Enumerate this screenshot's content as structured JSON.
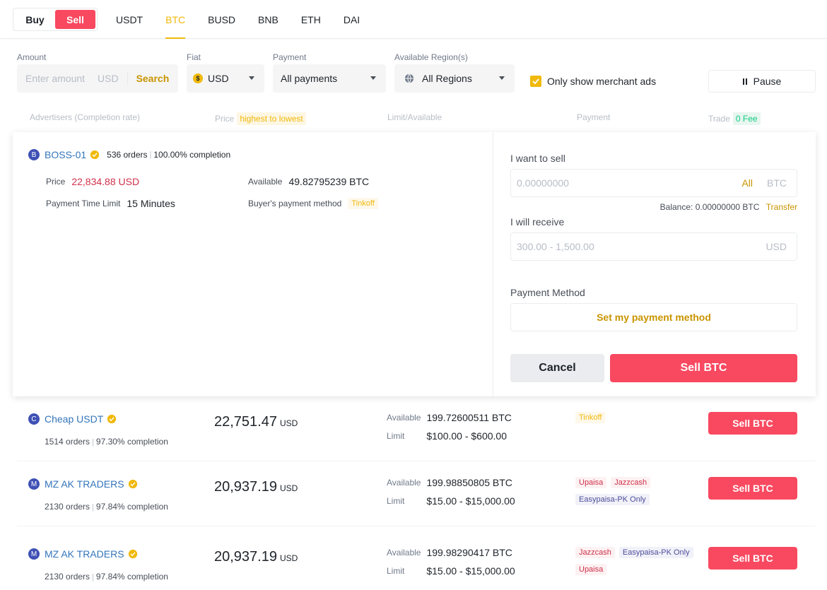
{
  "trade_toggle": {
    "buy": "Buy",
    "sell": "Sell"
  },
  "assets": [
    "USDT",
    "BTC",
    "BUSD",
    "BNB",
    "ETH",
    "DAI"
  ],
  "active_asset": "BTC",
  "filters": {
    "amount_label": "Amount",
    "amount_placeholder": "Enter amount",
    "amount_unit": "USD",
    "search": "Search",
    "fiat_label": "Fiat",
    "fiat_value": "USD",
    "fiat_icon": "$",
    "payment_label": "Payment",
    "payment_value": "All payments",
    "region_label": "Available Region(s)",
    "region_value": "All Regions",
    "merchant_only": "Only show merchant ads",
    "pause": "Pause"
  },
  "columns": {
    "advertisers": "Advertisers (Completion rate)",
    "price": "Price",
    "price_sort": "highest to lowest",
    "limit": "Limit/Available",
    "payment": "Payment",
    "trade": "Trade",
    "fee": "0 Fee"
  },
  "expanded": {
    "avatar": "B",
    "name": "BOSS-01",
    "orders": "536 orders",
    "completion": "100.00% completion",
    "price_label": "Price",
    "price": "22,834.88 USD",
    "available_label": "Available",
    "available": "49.82795239 BTC",
    "time_label": "Payment Time Limit",
    "time": "15 Minutes",
    "buyer_pm_label": "Buyer's payment method",
    "buyer_pm": "Tinkoff",
    "want_sell_label": "I want to sell",
    "sell_placeholder": "0.00000000",
    "all": "All",
    "sell_unit": "BTC",
    "balance": "Balance: 0.00000000 BTC",
    "transfer": "Transfer",
    "receive_label": "I will receive",
    "receive_placeholder": "300.00 - 1,500.00",
    "receive_unit": "USD",
    "pm_label": "Payment Method",
    "set_pm": "Set my payment method",
    "cancel": "Cancel",
    "sell_btn": "Sell BTC"
  },
  "rows": [
    {
      "avatar": "C",
      "name": "Cheap USDT",
      "orders": "1514 orders",
      "completion": "97.30% completion",
      "price": "22,751.47",
      "currency": "USD",
      "available_label": "Available",
      "available": "199.72600511 BTC",
      "limit_label": "Limit",
      "limit": "$100.00 - $600.00",
      "payments": [
        {
          "name": "Tinkoff",
          "color": "#f0b90b"
        }
      ],
      "action": "Sell BTC"
    },
    {
      "avatar": "M",
      "name": "MZ AK TRADERS",
      "orders": "2130 orders",
      "completion": "97.84% completion",
      "price": "20,937.19",
      "currency": "USD",
      "available_label": "Available",
      "available": "199.98850805 BTC",
      "limit_label": "Limit",
      "limit": "$15.00 - $15,000.00",
      "payments": [
        {
          "name": "Upaisa",
          "color": "#cf304a"
        },
        {
          "name": "Jazzcash",
          "color": "#cf304a"
        },
        {
          "name": "Easypaisa-PK Only",
          "color": "#4c4e9a"
        }
      ],
      "action": "Sell BTC"
    },
    {
      "avatar": "M",
      "name": "MZ AK TRADERS",
      "orders": "2130 orders",
      "completion": "97.84% completion",
      "price": "20,937.19",
      "currency": "USD",
      "available_label": "Available",
      "available": "199.98290417 BTC",
      "limit_label": "Limit",
      "limit": "$15.00 - $15,000.00",
      "payments": [
        {
          "name": "Jazzcash",
          "color": "#cf304a"
        },
        {
          "name": "Easypaisa-PK Only",
          "color": "#4c4e9a"
        },
        {
          "name": "Upaisa",
          "color": "#cf304a"
        }
      ],
      "action": "Sell BTC"
    }
  ],
  "colors": {
    "accent": "#f0b90b",
    "sell": "#f84960",
    "link": "#3375bb"
  }
}
